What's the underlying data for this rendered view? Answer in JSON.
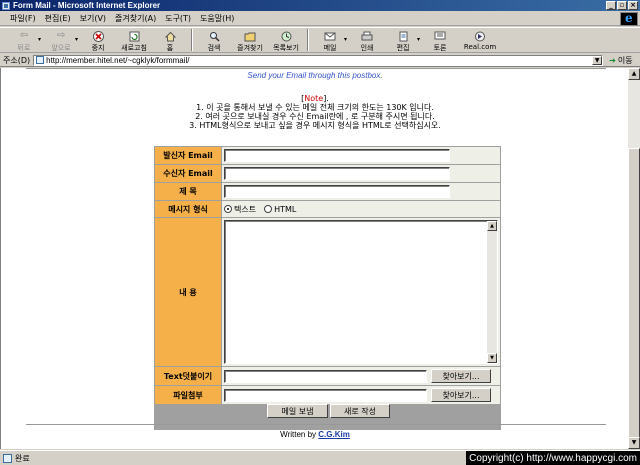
{
  "window": {
    "title": "Form Mail - Microsoft Internet Explorer",
    "controls": [
      "_",
      "▫",
      "×"
    ]
  },
  "menu": [
    "파일(F)",
    "편집(E)",
    "보기(V)",
    "즐겨찾기(A)",
    "도구(T)",
    "도움말(H)"
  ],
  "toolbar": {
    "back": "뒤로",
    "forward": "앞으로",
    "stop": "중지",
    "refresh": "새로고침",
    "home": "홈",
    "search": "검색",
    "favorites": "즐겨찾기",
    "history": "목록보기",
    "mail": "메일",
    "print": "인쇄",
    "edit": "편집",
    "discuss": "토론",
    "realcom": "Real.com"
  },
  "address": {
    "label": "주소(D)",
    "url": "http://member.hitel.net/~cgklyk/formmail/",
    "go": "이동"
  },
  "page": {
    "subtitle": "Send your Email through this postbox.",
    "note_prefix": "[",
    "note_tag": "Note",
    "note_suffix": "].",
    "notes": [
      "1. 이 곳을 통해서 보낼 수 있는 메일 전체 크기의 한도는 130K 입니다.",
      "2. 여러 곳으로 보내실 경우 수신 Email란에 , 로 구분해 주시면 됩니다.",
      "3. HTML형식으로 보내고 싶을 경우 메시지 형식을 HTML로 선택하십시오."
    ],
    "form": {
      "sender_label": "발신자 Email",
      "recipient_label": "수신자 Email",
      "subject_label": "제 목",
      "format_label": "메시지 형식",
      "format_text": "텍스트",
      "format_html": "HTML",
      "body_label": "내 용",
      "text_attach_label": "Text덧붙이기",
      "file_attach_label": "파일첨부",
      "browse": "찾아보기...",
      "send": "메일 보냄",
      "reset": "새로 작성"
    },
    "credit_prefix": "Written by",
    "credit_author": "C.G.Kim"
  },
  "status": {
    "text": "완료",
    "copyright": "Copyright(c) http://www.happycgi.com"
  }
}
